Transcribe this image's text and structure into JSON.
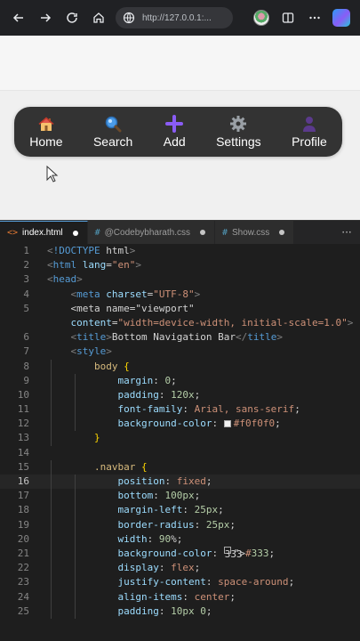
{
  "browser": {
    "url": "http://127.0.0.1:...",
    "icons": [
      "back-icon",
      "forward-icon",
      "refresh-icon",
      "home-icon",
      "site-info-icon",
      "profile-avatar",
      "split-screen-icon",
      "more-icon",
      "copilot-icon"
    ]
  },
  "preview": {
    "nav_items": [
      {
        "label": "Home",
        "icon": "house-icon"
      },
      {
        "label": "Search",
        "icon": "search-icon"
      },
      {
        "label": "Add",
        "icon": "plus-icon"
      },
      {
        "label": "Settings",
        "icon": "gear-icon"
      },
      {
        "label": "Profile",
        "icon": "person-icon"
      }
    ],
    "colors": {
      "page_bg": "#f0f0f0",
      "navbar_bg": "#333333",
      "plus": "#8a5cf6"
    }
  },
  "editor": {
    "tabs": [
      {
        "glyph": "<>",
        "name": "index.html",
        "active": true
      },
      {
        "glyph": "#",
        "name": "@Codebybharath.css",
        "active": false
      },
      {
        "glyph": "#",
        "name": "Show.css",
        "active": false
      }
    ],
    "current_line": 16,
    "lines": [
      {
        "n": "1",
        "text": "<!DOCTYPE html>"
      },
      {
        "n": "2",
        "text": "<html lang=\"en\">"
      },
      {
        "n": "3",
        "text": "<head>"
      },
      {
        "n": "4",
        "text": "    <meta charset=\"UTF-8\">"
      },
      {
        "n": "5",
        "text": "    <meta name=\"viewport\""
      },
      {
        "n": "",
        "text": "    content=\"width=device-width, initial-scale=1.0\">"
      },
      {
        "n": "6",
        "text": "    <title>Bottom Navigation Bar</title>"
      },
      {
        "n": "7",
        "text": "    <style>"
      },
      {
        "n": "8",
        "text": "        body {"
      },
      {
        "n": "9",
        "text": "            margin: 0;"
      },
      {
        "n": "10",
        "text": "            padding: 120x;"
      },
      {
        "n": "11",
        "text": "            font-family: Arial, sans-serif;"
      },
      {
        "n": "12",
        "text": "            background-color: #f0f0f0;"
      },
      {
        "n": "13",
        "text": "        }"
      },
      {
        "n": "14",
        "text": ""
      },
      {
        "n": "15",
        "text": "        .navbar {"
      },
      {
        "n": "16",
        "text": "            position: fixed;"
      },
      {
        "n": "17",
        "text": "            bottom: 100px;"
      },
      {
        "n": "18",
        "text": "            margin-left: 25px;"
      },
      {
        "n": "19",
        "text": "            border-radius: 25px;"
      },
      {
        "n": "20",
        "text": "            width: 90%;"
      },
      {
        "n": "21",
        "text": "            background-color: #333;"
      },
      {
        "n": "22",
        "text": "            display: flex;"
      },
      {
        "n": "23",
        "text": "            justify-content: space-around;"
      },
      {
        "n": "24",
        "text": "            align-items: center;"
      },
      {
        "n": "25",
        "text": "            padding: 10px 0;"
      }
    ]
  }
}
